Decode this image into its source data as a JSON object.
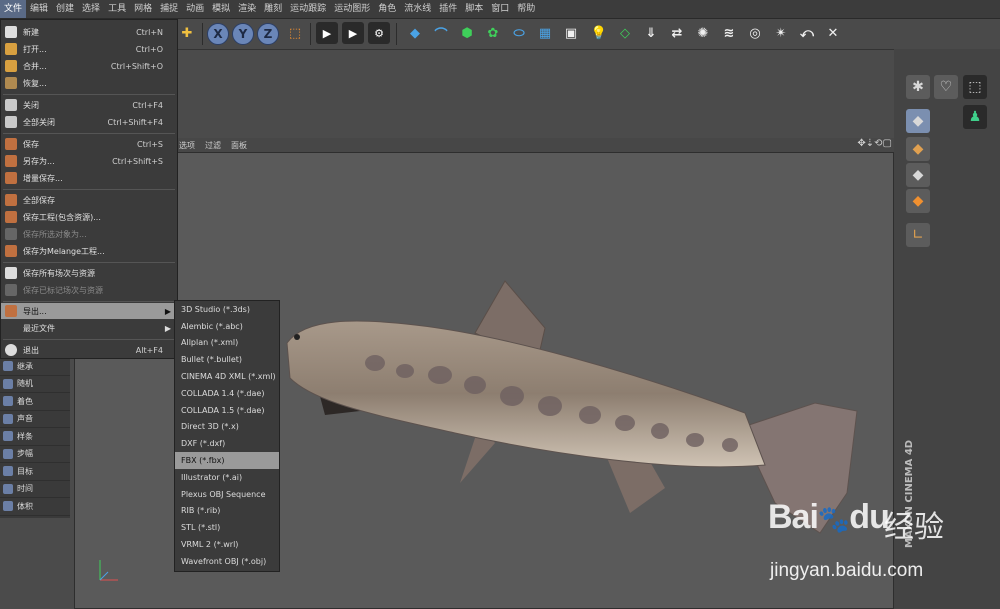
{
  "menubar": {
    "items": [
      "文件",
      "编辑",
      "创建",
      "选择",
      "工具",
      "网格",
      "捕捉",
      "动画",
      "模拟",
      "渲染",
      "雕刻",
      "运动跟踪",
      "运动图形",
      "角色",
      "流水线",
      "插件",
      "脚本",
      "窗口",
      "帮助"
    ]
  },
  "toolbar": {
    "axis_x": "X",
    "axis_y": "Y",
    "axis_z": "Z"
  },
  "viewport": {
    "menu": [
      "选项",
      "过滤",
      "面板"
    ]
  },
  "file_menu": {
    "items": [
      {
        "label": "新建",
        "shortcut": "Ctrl+N"
      },
      {
        "label": "打开...",
        "shortcut": "Ctrl+O"
      },
      {
        "label": "合并...",
        "shortcut": "Ctrl+Shift+O"
      },
      {
        "label": "恢复...",
        "shortcut": ""
      },
      {
        "label": "关闭",
        "shortcut": "Ctrl+F4"
      },
      {
        "label": "全部关闭",
        "shortcut": "Ctrl+Shift+F4"
      },
      {
        "label": "保存",
        "shortcut": "Ctrl+S"
      },
      {
        "label": "另存为...",
        "shortcut": "Ctrl+Shift+S"
      },
      {
        "label": "增量保存...",
        "shortcut": ""
      },
      {
        "label": "全部保存",
        "shortcut": ""
      },
      {
        "label": "保存工程(包含资源)...",
        "shortcut": ""
      },
      {
        "label": "保存所选对象为...",
        "shortcut": ""
      },
      {
        "label": "保存为Melange工程...",
        "shortcut": ""
      },
      {
        "label": "保存所有场次与资源",
        "shortcut": ""
      },
      {
        "label": "保存已标记场次与资源",
        "shortcut": ""
      },
      {
        "label": "导出...",
        "shortcut": ""
      },
      {
        "label": "最近文件",
        "shortcut": ""
      },
      {
        "label": "退出",
        "shortcut": "Alt+F4"
      }
    ]
  },
  "export_submenu": {
    "items": [
      "3D Studio (*.3ds)",
      "Alembic (*.abc)",
      "Allplan (*.xml)",
      "Bullet (*.bullet)",
      "CINEMA 4D XML (*.xml)",
      "COLLADA 1.4 (*.dae)",
      "COLLADA 1.5 (*.dae)",
      "Direct 3D (*.x)",
      "DXF (*.dxf)",
      "FBX (*.fbx)",
      "Illustrator (*.ai)",
      "Plexus OBJ Sequence",
      "RIB (*.rib)",
      "STL (*.stl)",
      "VRML 2 (*.wrl)",
      "Wavefront OBJ (*.obj)"
    ],
    "selected": "FBX (*.fbx)"
  },
  "left_panel": {
    "items": [
      "继承",
      "随机",
      "着色",
      "声音",
      "样条",
      "步幅",
      "目标",
      "时间",
      "体积"
    ]
  },
  "watermark": {
    "logo": "Bai",
    "logo2": "du",
    "cn": "经验",
    "url": "jingyan.baidu.com"
  },
  "brand": "MAXON CINEMA 4D",
  "colors": {
    "accent": "#6a86b8",
    "highlight": "#9a9a9a",
    "fish_body": "#8a7a6a"
  }
}
